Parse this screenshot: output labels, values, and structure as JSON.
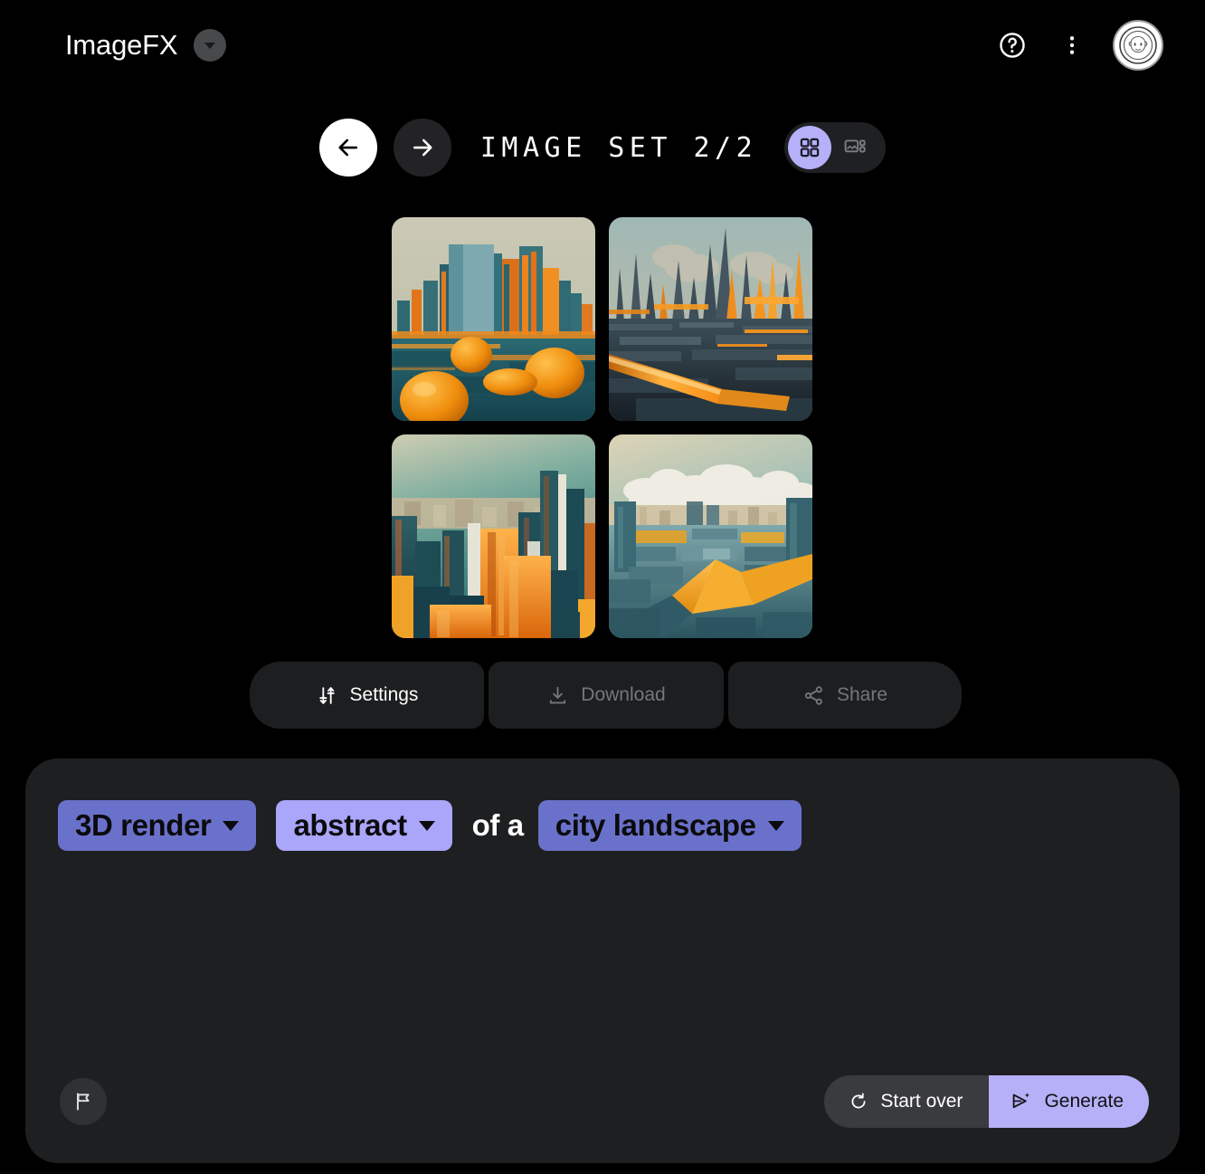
{
  "app": {
    "title": "ImageFX",
    "brand_dropdown_icon": "chevron-down-icon",
    "background": "#000000",
    "accent_purple": "#b5b0f7",
    "chip_purple": "#6a71cb",
    "chip_purple_light": "#aaa6fa"
  },
  "topbar": {
    "help_icon": "help-circle-icon",
    "menu_icon": "more-vertical-icon",
    "avatar_icon": "user-avatar-icon"
  },
  "navigation": {
    "back_icon": "arrow-left-icon",
    "forward_icon": "arrow-right-icon",
    "set_label": "IMAGE SET 2/2",
    "current_set": 2,
    "total_sets": 2,
    "view_toggle": {
      "grid_icon": "grid-view-icon",
      "detail_icon": "detail-view-icon",
      "active": "grid"
    }
  },
  "results": {
    "count": 4,
    "images": [
      {
        "alt": "3D render abstract city landscape with teal towers and orange spheres"
      },
      {
        "alt": "3D render abstract city landscape with glowing orange spires and smoke"
      },
      {
        "alt": "3D render abstract city landscape with blocky orange and teal buildings"
      },
      {
        "alt": "3D render abstract aerial city landscape with clouds and orange beam"
      }
    ]
  },
  "actions": [
    {
      "label": "Settings",
      "icon": "tune-icon",
      "enabled": true
    },
    {
      "label": "Download",
      "icon": "download-icon",
      "enabled": false
    },
    {
      "label": "Share",
      "icon": "share-icon",
      "enabled": false
    }
  ],
  "prompt": {
    "chips": [
      {
        "value": "3D render",
        "dropdown_icon": "chevron-down-icon"
      },
      {
        "value": "abstract",
        "dropdown_icon": "chevron-down-icon"
      },
      {
        "value": "city landscape",
        "dropdown_icon": "chevron-down-icon"
      }
    ],
    "connector_text": "of a",
    "full_text": "3D render abstract of a city landscape"
  },
  "footer": {
    "report_icon": "flag-icon",
    "start_over": {
      "label": "Start over",
      "icon": "refresh-icon"
    },
    "generate": {
      "label": "Generate",
      "icon": "send-sparkle-icon"
    }
  }
}
